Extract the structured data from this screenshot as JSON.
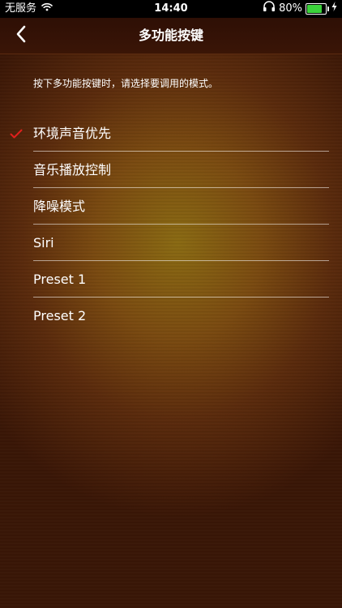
{
  "status_bar": {
    "carrier": "无服务",
    "time": "14:40",
    "battery_percent": "80%",
    "battery_level": 0.8,
    "battery_color": "#3bd23b"
  },
  "nav": {
    "title": "多功能按键"
  },
  "instruction": "按下多功能按键时，请选择要调用的模式。",
  "options": [
    {
      "label": "环境声音优先",
      "selected": true
    },
    {
      "label": "音乐播放控制",
      "selected": false
    },
    {
      "label": "降噪模式",
      "selected": false
    },
    {
      "label": "Siri",
      "selected": false
    },
    {
      "label": "Preset 1",
      "selected": false
    },
    {
      "label": "Preset 2",
      "selected": false
    }
  ],
  "colors": {
    "checkmark": "#e0201c"
  },
  "icons": {
    "back": "chevron-left-icon",
    "wifi": "wifi-icon",
    "headphones": "headphones-icon",
    "battery": "battery-icon",
    "charging": "lightning-icon",
    "check": "checkmark-icon"
  }
}
